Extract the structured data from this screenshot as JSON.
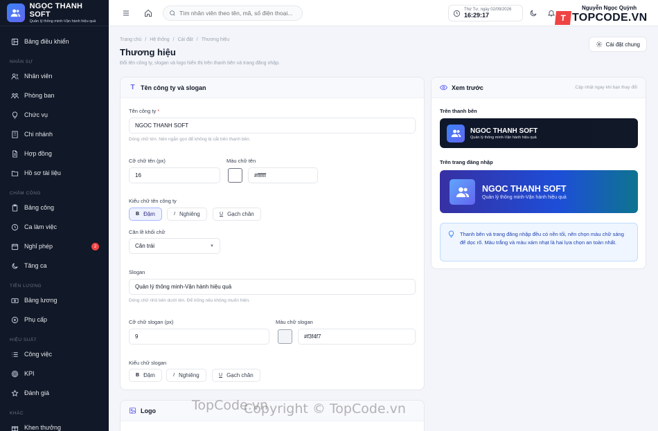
{
  "brand": {
    "name": "NGỌC THANH SOFT",
    "slogan": "Quản lý thông minh-Vận hành hiệu quả"
  },
  "sidebar": {
    "dashboard": "Bảng điều khiển",
    "sections": {
      "hr": "NHÂN SỰ",
      "attendance": "CHẤM CÔNG",
      "salary": "TIỀN LƯƠNG",
      "performance": "HIỆU SUẤT",
      "other": "KHÁC"
    },
    "items": {
      "employees": "Nhân viên",
      "departments": "Phòng ban",
      "positions": "Chức vụ",
      "branches": "Chi nhánh",
      "contracts": "Hợp đồng",
      "documents": "Hồ sơ tài liệu",
      "timesheet": "Bảng công",
      "shifts": "Ca làm việc",
      "leave": "Nghỉ phép",
      "leave_badge": "2",
      "overtime": "Tăng ca",
      "payroll": "Bảng lương",
      "allowance": "Phụ cấp",
      "tasks": "Công việc",
      "kpi": "KPI",
      "review": "Đánh giá",
      "reward": "Khen thưởng"
    }
  },
  "topbar": {
    "search_placeholder": "Tìm nhân viên theo tên, mã, số điện thoại...",
    "date": "Thứ Tư, ngày 02/09/2026",
    "time": "16:29:17",
    "user_name": "Nguyễn Ngọc Quỳnh",
    "topcode_badge": "T",
    "topcode_text": "TOPCODE.VN"
  },
  "page": {
    "breadcrumb": [
      "Trang chủ",
      "Hệ thống",
      "Cài đặt",
      "Thương hiệu"
    ],
    "title": "Thương hiệu",
    "description": "Đổi tên công ty, slogan và logo hiển thị trên thanh bên và trang đăng nhập.",
    "settings_button": "Cài đặt chung"
  },
  "form": {
    "card_title": "Tên công ty và slogan",
    "company_label": "Tên công ty",
    "required_mark": "*",
    "company_value": "NGOC THANH SOFT",
    "company_hint": "Dòng chữ lớn. Nên ngắn gọn để không bị cắt trên thanh bên.",
    "name_size_label": "Cỡ chữ tên (px)",
    "name_size_value": "16",
    "name_color_label": "Màu chữ tên",
    "name_color_value": "#ffffff",
    "name_style_label": "Kiểu chữ tên công ty",
    "bold": "Đậm",
    "italic": "Nghiêng",
    "underline": "Gạch chân",
    "bold_glyph": "B",
    "italic_glyph": "I",
    "underline_glyph": "U",
    "align_label": "Căn lề khối chữ",
    "align_value": "Căn trái",
    "slogan_label": "Slogan",
    "slogan_value": "Quản lý thông minh-Vận hành hiệu quả",
    "slogan_hint": "Dòng chữ nhỏ bên dưới tên. Để trống nếu không muốn hiện.",
    "slogan_size_label": "Cỡ chữ slogan (px)",
    "slogan_size_value": "9",
    "slogan_color_label": "Màu chữ slogan",
    "slogan_color_value": "#f3f4f7",
    "slogan_style_label": "Kiểu chữ slogan",
    "title_glyph": "T"
  },
  "logo_card": {
    "title": "Logo"
  },
  "preview": {
    "title": "Xem trước",
    "note": "Cập nhật ngay khi bạn thay đổi",
    "sidebar_label": "Trên thanh bên",
    "login_label": "Trên trang đăng nhập",
    "brand_name": "NGOC THANH SOFT",
    "brand_slogan": "Quản lý thông minh-Vận hành hiệu quả",
    "tip": "Thanh bên và trang đăng nhập đều có nền tối, nên chọn màu chữ sáng để dọc rõ. Màu trắng và màu xám nhạt là hai lựa chọn an toàn nhất."
  },
  "watermarks": {
    "a": "TopCode.vn",
    "b": "Copyright © TopCode.vn"
  },
  "colors": {
    "sidebar_bg": "#111827",
    "accent": "#6366f1",
    "danger": "#ef4444"
  }
}
